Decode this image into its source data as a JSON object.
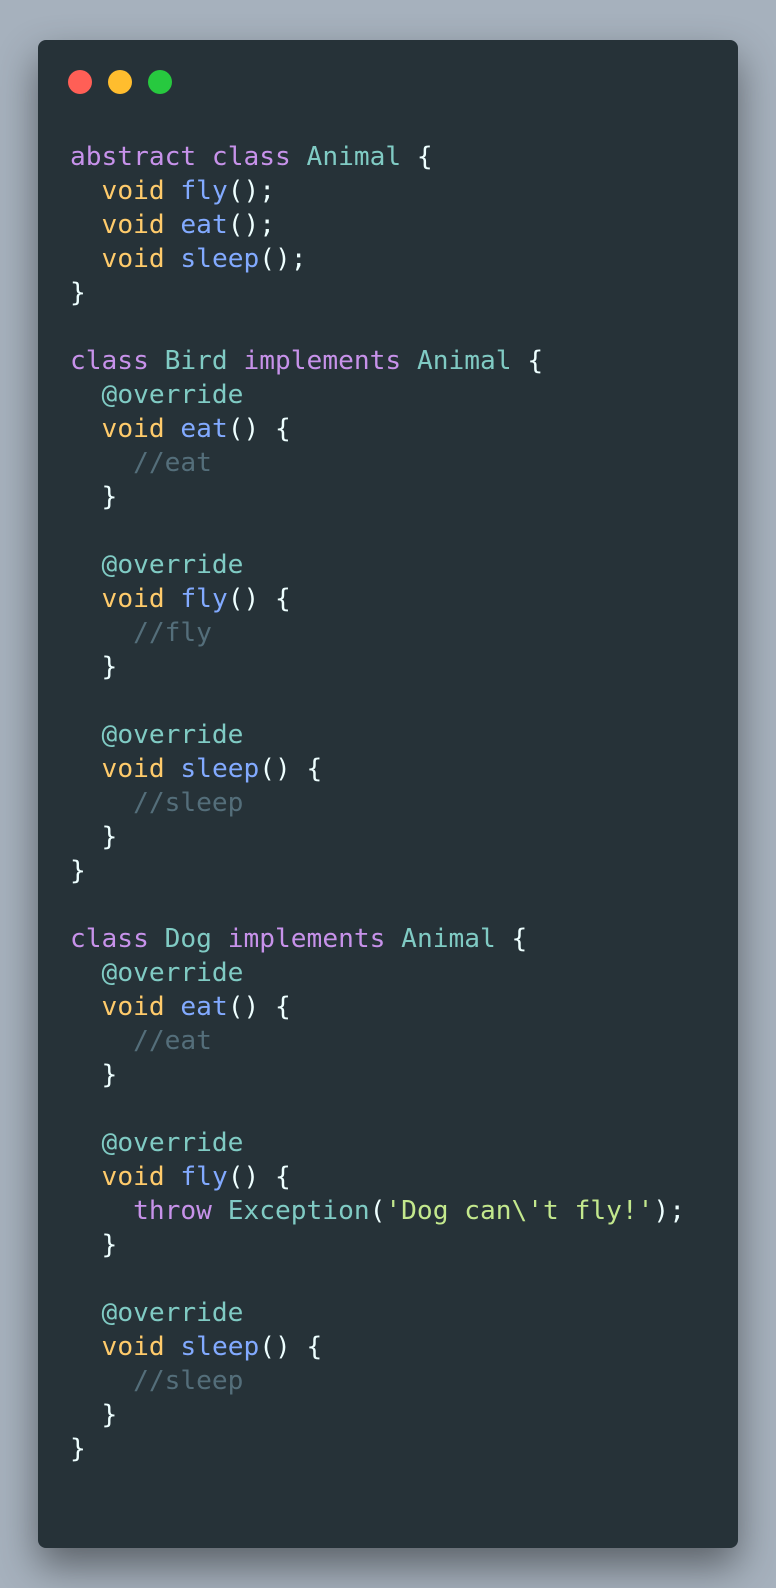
{
  "window": {
    "controls": [
      {
        "name": "close-dot",
        "color": "#ff5f56"
      },
      {
        "name": "minimize-dot",
        "color": "#ffbd2e"
      },
      {
        "name": "maximize-dot",
        "color": "#27c93f"
      }
    ]
  },
  "colors": {
    "background": "#a6b1bd",
    "window": "#263238",
    "keyword": "#c792ea",
    "class": "#80cbc4",
    "type": "#ffcb6b",
    "function": "#82aaff",
    "punctuation": "#eeffff",
    "comment": "#546e7a",
    "string": "#c3e88d"
  },
  "code": {
    "lines": [
      [
        {
          "t": "abstract",
          "k": "keyword"
        },
        {
          "t": " ",
          "k": "plain"
        },
        {
          "t": "class",
          "k": "keyword"
        },
        {
          "t": " ",
          "k": "plain"
        },
        {
          "t": "Animal",
          "k": "class"
        },
        {
          "t": " {",
          "k": "punct"
        }
      ],
      [
        {
          "t": "  ",
          "k": "plain"
        },
        {
          "t": "void",
          "k": "type"
        },
        {
          "t": " ",
          "k": "plain"
        },
        {
          "t": "fly",
          "k": "func"
        },
        {
          "t": "();",
          "k": "punct"
        }
      ],
      [
        {
          "t": "  ",
          "k": "plain"
        },
        {
          "t": "void",
          "k": "type"
        },
        {
          "t": " ",
          "k": "plain"
        },
        {
          "t": "eat",
          "k": "func"
        },
        {
          "t": "();",
          "k": "punct"
        }
      ],
      [
        {
          "t": "  ",
          "k": "plain"
        },
        {
          "t": "void",
          "k": "type"
        },
        {
          "t": " ",
          "k": "plain"
        },
        {
          "t": "sleep",
          "k": "func"
        },
        {
          "t": "();",
          "k": "punct"
        }
      ],
      [
        {
          "t": "}",
          "k": "punct"
        }
      ],
      [],
      [
        {
          "t": "class",
          "k": "keyword"
        },
        {
          "t": " ",
          "k": "plain"
        },
        {
          "t": "Bird",
          "k": "class"
        },
        {
          "t": " ",
          "k": "plain"
        },
        {
          "t": "implements",
          "k": "keyword"
        },
        {
          "t": " ",
          "k": "plain"
        },
        {
          "t": "Animal",
          "k": "class"
        },
        {
          "t": " {",
          "k": "punct"
        }
      ],
      [
        {
          "t": "  ",
          "k": "plain"
        },
        {
          "t": "@override",
          "k": "annotation"
        }
      ],
      [
        {
          "t": "  ",
          "k": "plain"
        },
        {
          "t": "void",
          "k": "type"
        },
        {
          "t": " ",
          "k": "plain"
        },
        {
          "t": "eat",
          "k": "func"
        },
        {
          "t": "() {",
          "k": "punct"
        }
      ],
      [
        {
          "t": "    ",
          "k": "plain"
        },
        {
          "t": "//eat",
          "k": "comment"
        }
      ],
      [
        {
          "t": "  }",
          "k": "punct"
        }
      ],
      [],
      [
        {
          "t": "  ",
          "k": "plain"
        },
        {
          "t": "@override",
          "k": "annotation"
        }
      ],
      [
        {
          "t": "  ",
          "k": "plain"
        },
        {
          "t": "void",
          "k": "type"
        },
        {
          "t": " ",
          "k": "plain"
        },
        {
          "t": "fly",
          "k": "func"
        },
        {
          "t": "() {",
          "k": "punct"
        }
      ],
      [
        {
          "t": "    ",
          "k": "plain"
        },
        {
          "t": "//fly",
          "k": "comment"
        }
      ],
      [
        {
          "t": "  }",
          "k": "punct"
        }
      ],
      [],
      [
        {
          "t": "  ",
          "k": "plain"
        },
        {
          "t": "@override",
          "k": "annotation"
        }
      ],
      [
        {
          "t": "  ",
          "k": "plain"
        },
        {
          "t": "void",
          "k": "type"
        },
        {
          "t": " ",
          "k": "plain"
        },
        {
          "t": "sleep",
          "k": "func"
        },
        {
          "t": "() {",
          "k": "punct"
        }
      ],
      [
        {
          "t": "    ",
          "k": "plain"
        },
        {
          "t": "//sleep",
          "k": "comment"
        }
      ],
      [
        {
          "t": "  }",
          "k": "punct"
        }
      ],
      [
        {
          "t": "}",
          "k": "punct"
        }
      ],
      [],
      [
        {
          "t": "class",
          "k": "keyword"
        },
        {
          "t": " ",
          "k": "plain"
        },
        {
          "t": "Dog",
          "k": "class"
        },
        {
          "t": " ",
          "k": "plain"
        },
        {
          "t": "implements",
          "k": "keyword"
        },
        {
          "t": " ",
          "k": "plain"
        },
        {
          "t": "Animal",
          "k": "class"
        },
        {
          "t": " {",
          "k": "punct"
        }
      ],
      [
        {
          "t": "  ",
          "k": "plain"
        },
        {
          "t": "@override",
          "k": "annotation"
        }
      ],
      [
        {
          "t": "  ",
          "k": "plain"
        },
        {
          "t": "void",
          "k": "type"
        },
        {
          "t": " ",
          "k": "plain"
        },
        {
          "t": "eat",
          "k": "func"
        },
        {
          "t": "() {",
          "k": "punct"
        }
      ],
      [
        {
          "t": "    ",
          "k": "plain"
        },
        {
          "t": "//eat",
          "k": "comment"
        }
      ],
      [
        {
          "t": "  }",
          "k": "punct"
        }
      ],
      [],
      [
        {
          "t": "  ",
          "k": "plain"
        },
        {
          "t": "@override",
          "k": "annotation"
        }
      ],
      [
        {
          "t": "  ",
          "k": "plain"
        },
        {
          "t": "void",
          "k": "type"
        },
        {
          "t": " ",
          "k": "plain"
        },
        {
          "t": "fly",
          "k": "func"
        },
        {
          "t": "() {",
          "k": "punct"
        }
      ],
      [
        {
          "t": "    ",
          "k": "plain"
        },
        {
          "t": "throw",
          "k": "keyword"
        },
        {
          "t": " ",
          "k": "plain"
        },
        {
          "t": "Exception",
          "k": "class"
        },
        {
          "t": "(",
          "k": "punct"
        },
        {
          "t": "'Dog can\\'t fly!'",
          "k": "string"
        },
        {
          "t": ");",
          "k": "punct"
        }
      ],
      [
        {
          "t": "  }",
          "k": "punct"
        }
      ],
      [],
      [
        {
          "t": "  ",
          "k": "plain"
        },
        {
          "t": "@override",
          "k": "annotation"
        }
      ],
      [
        {
          "t": "  ",
          "k": "plain"
        },
        {
          "t": "void",
          "k": "type"
        },
        {
          "t": " ",
          "k": "plain"
        },
        {
          "t": "sleep",
          "k": "func"
        },
        {
          "t": "() {",
          "k": "punct"
        }
      ],
      [
        {
          "t": "    ",
          "k": "plain"
        },
        {
          "t": "//sleep",
          "k": "comment"
        }
      ],
      [
        {
          "t": "  }",
          "k": "punct"
        }
      ],
      [
        {
          "t": "}",
          "k": "punct"
        }
      ]
    ]
  }
}
